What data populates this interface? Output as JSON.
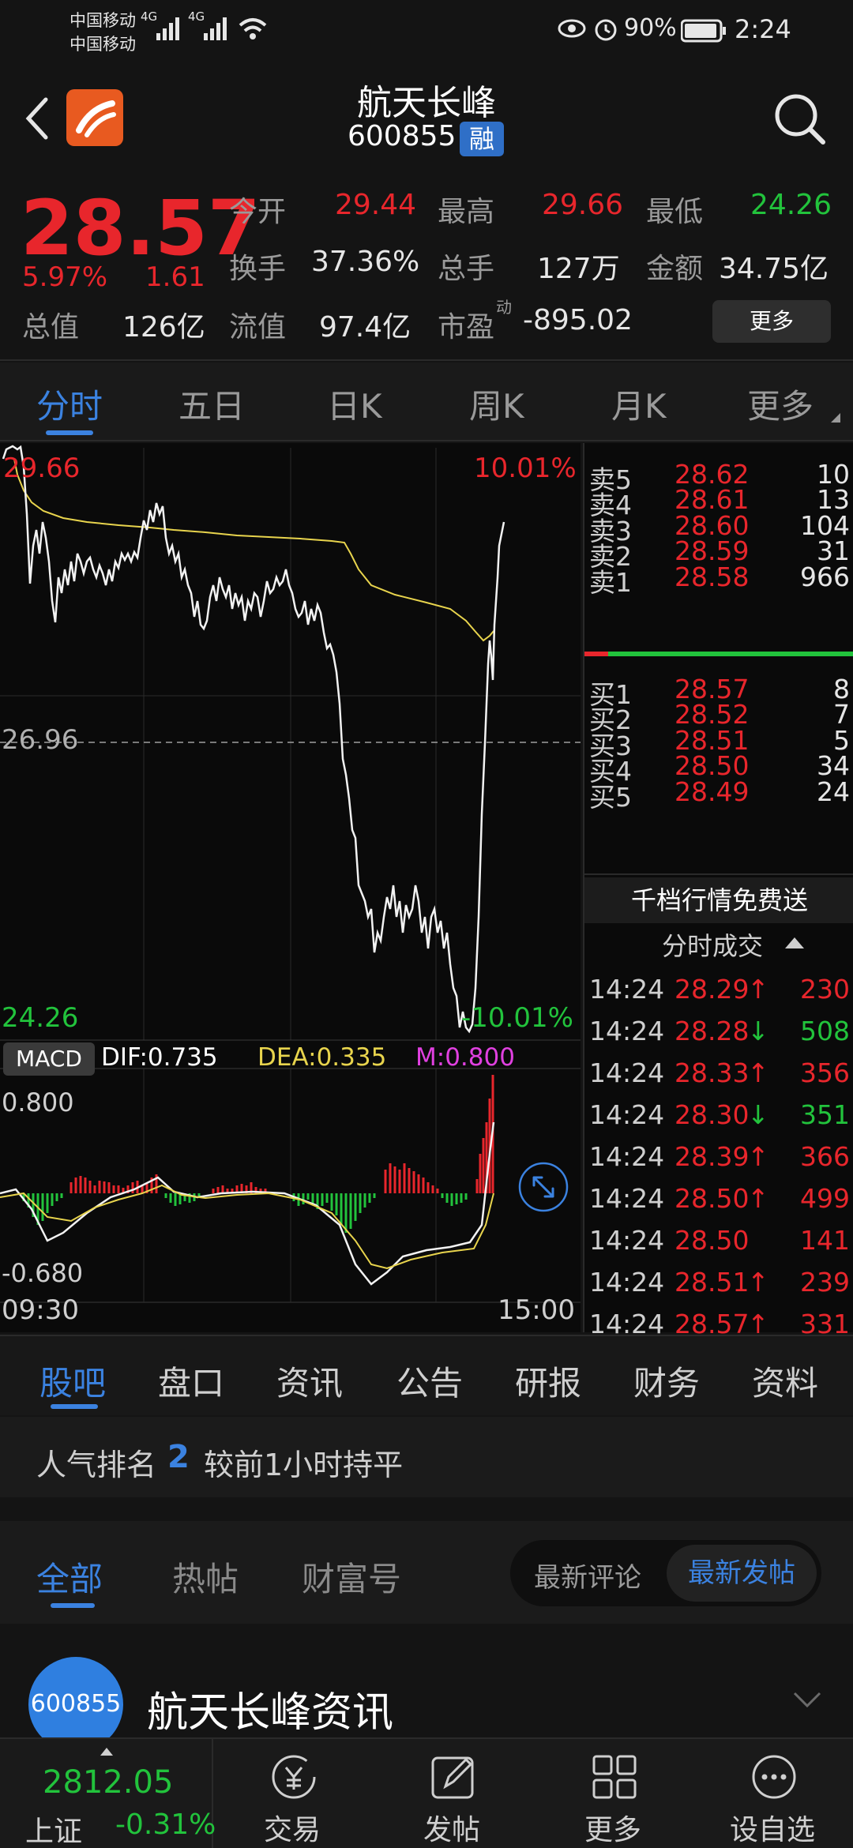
{
  "status": {
    "carrier1": "中国移动",
    "carrier2": "中国移动",
    "net1": "4G",
    "net2": "4G",
    "battery": "90%",
    "time": "2:24"
  },
  "header": {
    "name": "航天长峰",
    "code": "600855",
    "badge": "融"
  },
  "quote": {
    "price": "28.57",
    "pct": "5.97%",
    "change": "1.61",
    "open_label": "今开",
    "open": "29.44",
    "high_label": "最高",
    "high": "29.66",
    "low_label": "最低",
    "low": "24.26",
    "turnover_label": "换手",
    "turnover": "37.36%",
    "volume_label": "总手",
    "volume": "127万",
    "amount_label": "金额",
    "amount": "34.75亿",
    "mcap_label": "总值",
    "mcap": "126亿",
    "float_label": "流值",
    "float": "97.4亿",
    "pe_label": "市盈",
    "pe_sup": "动",
    "pe": "-895.02",
    "more_button": "更多"
  },
  "chart_tabs": [
    "分时",
    "五日",
    "日K",
    "周K",
    "月K",
    "更多"
  ],
  "chart_labels": {
    "top_price": "29.66",
    "top_pct": "10.01%",
    "mid_price": "26.96",
    "low_price": "24.26",
    "low_pct": "-10.01%",
    "macd_label": "MACD",
    "dif": "DIF:0.735",
    "dea": "DEA:0.335",
    "m": "M:0.800",
    "macd_top": "0.800",
    "macd_bottom": "-0.680",
    "time_start": "09:30",
    "time_end": "15:00"
  },
  "colors": {
    "red": "#e8262c",
    "green": "#22c33c",
    "accent": "#3b82e0",
    "avg_line": "#e8d44d",
    "dea": "#e8d44d",
    "m": "#e040e0"
  },
  "orderbook": {
    "asks": [
      {
        "label": "卖5",
        "price": "28.62",
        "qty": "10"
      },
      {
        "label": "卖4",
        "price": "28.61",
        "qty": "13"
      },
      {
        "label": "卖3",
        "price": "28.60",
        "qty": "104"
      },
      {
        "label": "卖2",
        "price": "28.59",
        "qty": "31"
      },
      {
        "label": "卖1",
        "price": "28.58",
        "qty": "966"
      }
    ],
    "bids": [
      {
        "label": "买1",
        "price": "28.57",
        "qty": "8"
      },
      {
        "label": "买2",
        "price": "28.52",
        "qty": "7"
      },
      {
        "label": "买3",
        "price": "28.51",
        "qty": "5"
      },
      {
        "label": "买4",
        "price": "28.50",
        "qty": "34"
      },
      {
        "label": "买5",
        "price": "28.49",
        "qty": "24"
      }
    ],
    "promo": "千档行情免费送",
    "trades_title": "分时成交",
    "trades": [
      {
        "time": "14:24",
        "price": "28.29",
        "dir": "↑",
        "qty": "230",
        "qcolor": "red"
      },
      {
        "time": "14:24",
        "price": "28.28",
        "dir": "↓",
        "qty": "508",
        "qcolor": "green"
      },
      {
        "time": "14:24",
        "price": "28.33",
        "dir": "↑",
        "qty": "356",
        "qcolor": "red"
      },
      {
        "time": "14:24",
        "price": "28.30",
        "dir": "↓",
        "qty": "351",
        "qcolor": "green"
      },
      {
        "time": "14:24",
        "price": "28.39",
        "dir": "↑",
        "qty": "366",
        "qcolor": "red"
      },
      {
        "time": "14:24",
        "price": "28.50",
        "dir": "↑",
        "qty": "499",
        "qcolor": "red"
      },
      {
        "time": "14:24",
        "price": "28.50",
        "dir": "",
        "qty": "141",
        "qcolor": "red"
      },
      {
        "time": "14:24",
        "price": "28.51",
        "dir": "↑",
        "qty": "239",
        "qcolor": "red"
      },
      {
        "time": "14:24",
        "price": "28.57",
        "dir": "↑",
        "qty": "331",
        "qcolor": "red"
      }
    ]
  },
  "sub_tabs": [
    "股吧",
    "盘口",
    "资讯",
    "公告",
    "研报",
    "财务",
    "资料"
  ],
  "rank": {
    "prefix": "人气排名",
    "value": "2",
    "suffix": "较前1小时持平"
  },
  "feed_tabs": [
    "全部",
    "热帖",
    "财富号"
  ],
  "feed_sort": [
    "最新评论",
    "最新发帖"
  ],
  "feed_item": {
    "avatar": "600855",
    "title": "航天长峰资讯"
  },
  "bottom_nav": {
    "index_value": "2812.05",
    "index_name": "上证",
    "index_pct": "-0.31%",
    "items": [
      "交易",
      "发帖",
      "更多",
      "设自选"
    ]
  }
}
